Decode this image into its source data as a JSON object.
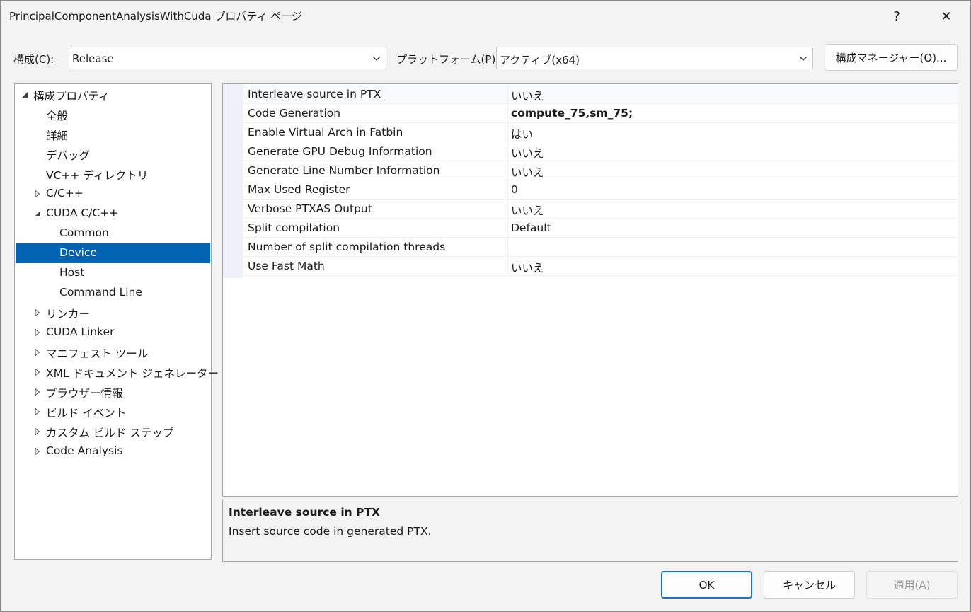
{
  "window": {
    "title": "PrincipalComponentAnalysisWithCuda プロパティ ページ",
    "help_glyph": "?",
    "close_glyph": "✕"
  },
  "config": {
    "config_label": "構成(C):",
    "config_value": "Release",
    "platform_label": "プラットフォーム(P):",
    "platform_value": "アクティブ(x64)",
    "manager_button": "構成マネージャー(O)..."
  },
  "tree": {
    "items": [
      {
        "label": "構成プロパティ",
        "expander": "expanded"
      },
      {
        "label": "全般",
        "expander": "none"
      },
      {
        "label": "詳細",
        "expander": "none"
      },
      {
        "label": "デバッグ",
        "expander": "none"
      },
      {
        "label": "VC++ ディレクトリ",
        "expander": "none"
      },
      {
        "label": "C/C++",
        "expander": "collapsed"
      },
      {
        "label": "CUDA C/C++",
        "expander": "expanded"
      },
      {
        "label": "Common",
        "expander": "none"
      },
      {
        "label": "Device",
        "expander": "none",
        "selected": true
      },
      {
        "label": "Host",
        "expander": "none"
      },
      {
        "label": "Command Line",
        "expander": "none"
      },
      {
        "label": "リンカー",
        "expander": "collapsed"
      },
      {
        "label": "CUDA Linker",
        "expander": "collapsed"
      },
      {
        "label": "マニフェスト ツール",
        "expander": "collapsed"
      },
      {
        "label": "XML ドキュメント ジェネレーター",
        "expander": "collapsed"
      },
      {
        "label": "ブラウザー情報",
        "expander": "collapsed"
      },
      {
        "label": "ビルド イベント",
        "expander": "collapsed"
      },
      {
        "label": "カスタム ビルド ステップ",
        "expander": "collapsed"
      },
      {
        "label": "Code Analysis",
        "expander": "collapsed"
      }
    ]
  },
  "properties": {
    "rows": [
      {
        "name": "Interleave source in PTX",
        "value": "いいえ",
        "bold": false
      },
      {
        "name": "Code Generation",
        "value": "compute_75,sm_75;",
        "bold": true
      },
      {
        "name": "Enable Virtual Arch in Fatbin",
        "value": "はい",
        "bold": false
      },
      {
        "name": "Generate GPU Debug Information",
        "value": "いいえ",
        "bold": false
      },
      {
        "name": "Generate Line Number Information",
        "value": "いいえ",
        "bold": false
      },
      {
        "name": "Max Used Register",
        "value": "0",
        "bold": false
      },
      {
        "name": "Verbose PTXAS Output",
        "value": "いいえ",
        "bold": false
      },
      {
        "name": "Split compilation",
        "value": "Default",
        "bold": false
      },
      {
        "name": "Number of split compilation threads",
        "value": "",
        "bold": false
      },
      {
        "name": "Use Fast Math",
        "value": "いいえ",
        "bold": false
      }
    ]
  },
  "description": {
    "title": "Interleave source in PTX",
    "text": "Insert source code in generated PTX."
  },
  "buttons": {
    "ok": "OK",
    "cancel": "キャンセル",
    "apply": "適用(A)"
  },
  "colors": {
    "selection": "#0063b1",
    "primary_border": "#1f6fc8"
  }
}
